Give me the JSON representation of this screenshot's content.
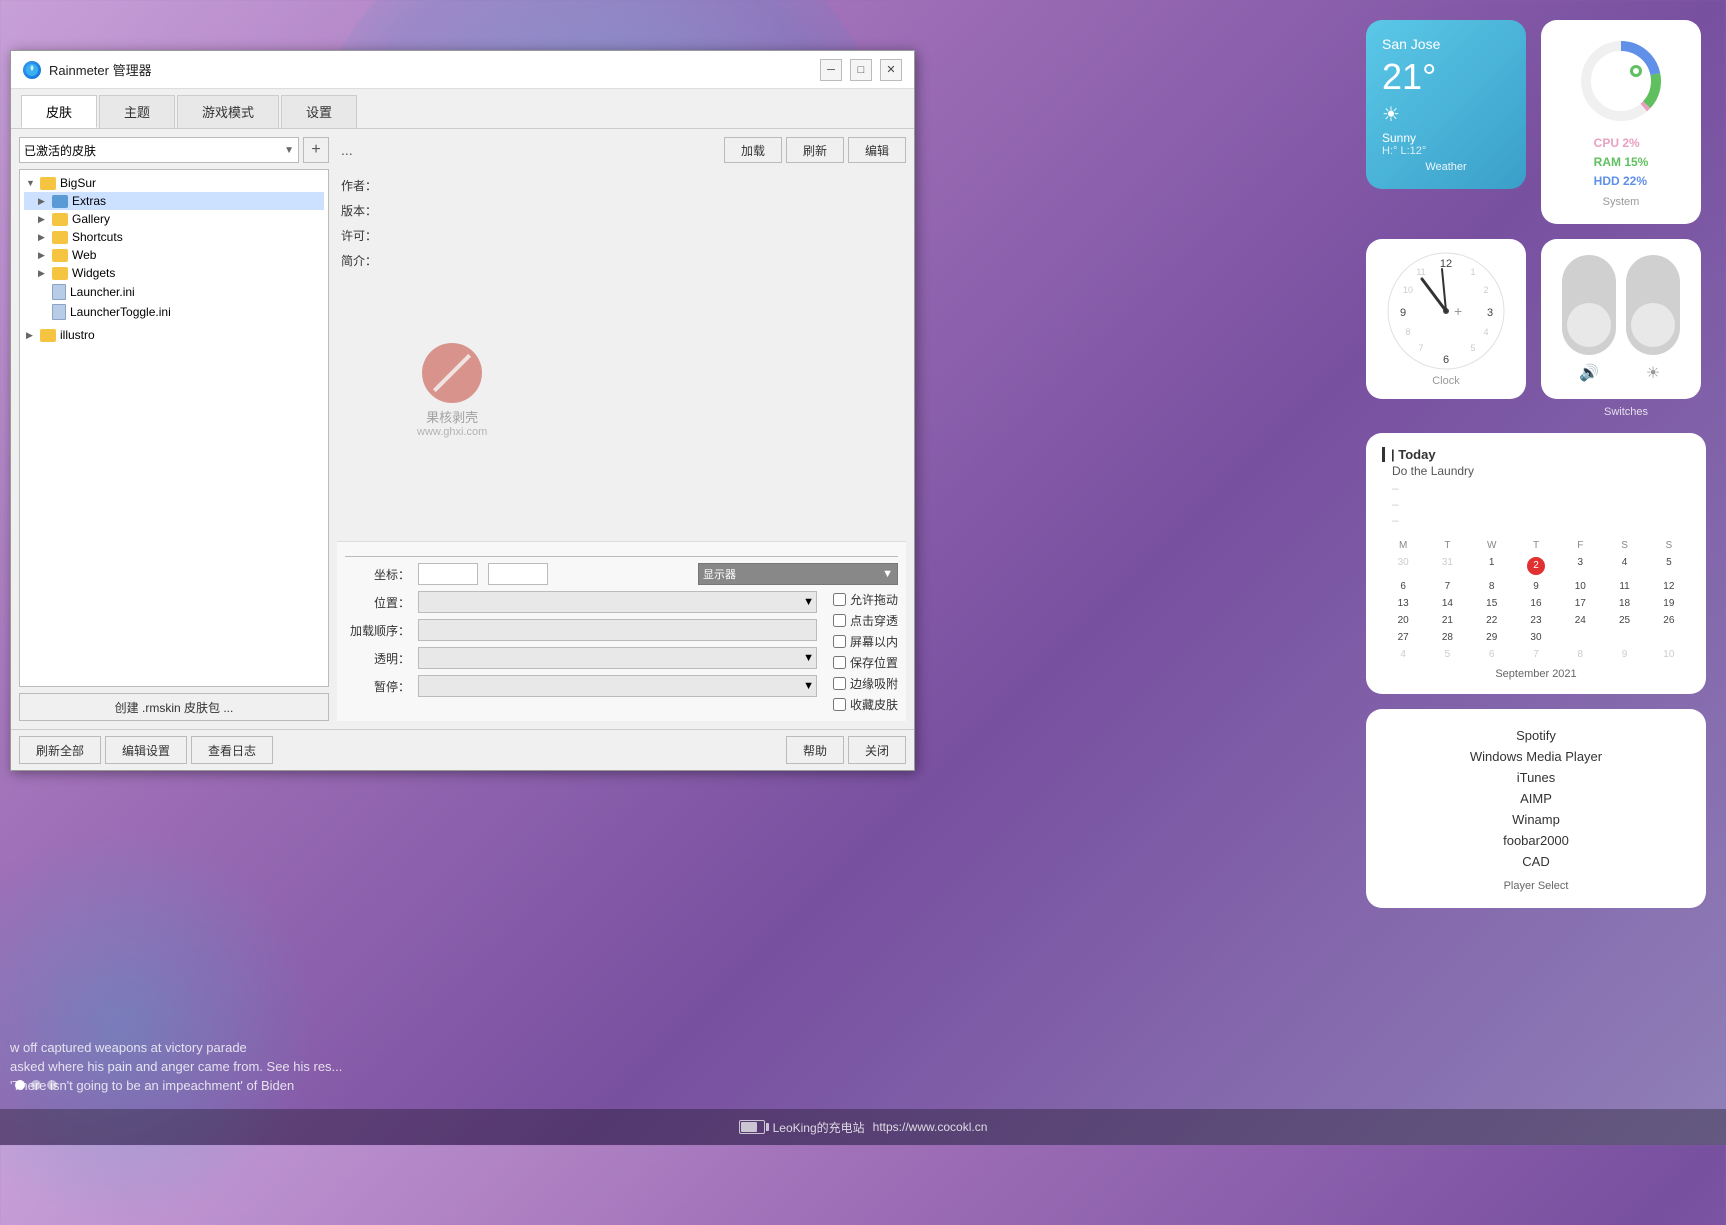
{
  "app": {
    "title": "Rainmeter 管理器",
    "icon": "rainmeter-icon"
  },
  "window_controls": {
    "minimize": "─",
    "maximize": "□",
    "close": "✕"
  },
  "tabs": [
    {
      "id": "skin",
      "label": "皮肤",
      "active": true
    },
    {
      "id": "theme",
      "label": "主题"
    },
    {
      "id": "game",
      "label": "游戏模式"
    },
    {
      "id": "settings",
      "label": "设置"
    }
  ],
  "skin_panel": {
    "dropdown_label": "已激活的皮肤",
    "add_btn": "+",
    "more_btn": "...",
    "load_btn": "加载",
    "refresh_btn": "刷新",
    "edit_btn": "编辑",
    "tree": {
      "root": {
        "name": "BigSur",
        "expanded": true,
        "children": [
          {
            "name": "Extras",
            "selected": true,
            "type": "folder",
            "color": "blue"
          },
          {
            "name": "Gallery",
            "type": "folder",
            "color": "yellow"
          },
          {
            "name": "Shortcuts",
            "type": "folder",
            "color": "yellow"
          },
          {
            "name": "Web",
            "type": "folder",
            "color": "yellow"
          },
          {
            "name": "Widgets",
            "type": "folder",
            "color": "yellow"
          },
          {
            "name": "Launcher.ini",
            "type": "file"
          },
          {
            "name": "LauncherToggle.ini",
            "type": "file"
          }
        ]
      },
      "root2": {
        "name": "illustro",
        "expanded": false
      }
    },
    "create_btn": "创建 .rmskin 皮肤包 ..."
  },
  "metadata": {
    "author_label": "作者：",
    "version_label": "版本：",
    "license_label": "许可：",
    "desc_label": "简介："
  },
  "properties": {
    "coord_label": "坐标：",
    "position_label": "位置：",
    "load_order_label": "加载顺序：",
    "transparent_label": "透明：",
    "pause_label": "暂停：",
    "monitor_label": "显示器",
    "checkboxes": [
      {
        "label": "允许拖动"
      },
      {
        "label": "点击穿透"
      },
      {
        "label": "屏幕以内"
      },
      {
        "label": "保存位置"
      },
      {
        "label": "边缘吸附"
      },
      {
        "label": "收藏皮肤"
      }
    ]
  },
  "footer": {
    "refresh_all": "刷新全部",
    "edit_settings": "编辑设置",
    "view_log": "查看日志",
    "help": "帮助",
    "close": "关闭"
  },
  "watermark": {
    "text": "果核剥壳",
    "url": "www.ghxi.com"
  },
  "weather_widget": {
    "city": "San Jose",
    "temp": "21°",
    "condition": "Sunny",
    "high_low": "H:° L:12°",
    "label": "Weather"
  },
  "system_widget": {
    "cpu": "CPU 2%",
    "ram": "RAM 15%",
    "hdd": "HDD 22%",
    "label": "System",
    "cpu_pct": 2,
    "ram_pct": 15,
    "hdd_pct": 22
  },
  "clock_widget": {
    "label": "Clock",
    "hour": 11,
    "minute": 58
  },
  "switches_widget": {
    "label": "Switches",
    "switches": [
      {
        "icon": "🔊"
      },
      {
        "icon": "☀"
      }
    ]
  },
  "calendar_widget": {
    "today_label": "| Today",
    "task": "Do the Laundry",
    "dashes": [
      "–",
      "–",
      "–"
    ],
    "month": "September 2021",
    "headers": [
      "M",
      "T",
      "W",
      "T",
      "F",
      "S",
      "S"
    ],
    "days": [
      [
        "",
        "",
        "1",
        "2",
        "3",
        "4",
        "5"
      ],
      [
        "6",
        "7",
        "8",
        "9",
        "10",
        "11",
        "12"
      ],
      [
        "13",
        "14",
        "15",
        "16",
        "17",
        "18",
        "19"
      ],
      [
        "20",
        "21",
        "22",
        "23",
        "24",
        "25",
        "26"
      ],
      [
        "27",
        "28",
        "29",
        "30",
        "",
        "",
        ""
      ],
      [
        "4",
        "5",
        "6",
        "7",
        "8",
        "9",
        "10"
      ]
    ],
    "today_date": "2",
    "label": "September 2021"
  },
  "player_widget": {
    "items": [
      "Spotify",
      "Windows Media Player",
      "iTunes",
      "AIMP",
      "Winamp",
      "foobar2000",
      "CAD"
    ],
    "label": "Player Select"
  },
  "bottom_news": {
    "title": "",
    "items": [
      "w off captured weapons at victory parade",
      "asked where his pain and anger came from. See his res...",
      "'There isn't going to be an impeachment' of Biden"
    ]
  },
  "bottom_bar": {
    "text": "LeoKing的充电站",
    "url": "https://www.cocokl.cn"
  }
}
